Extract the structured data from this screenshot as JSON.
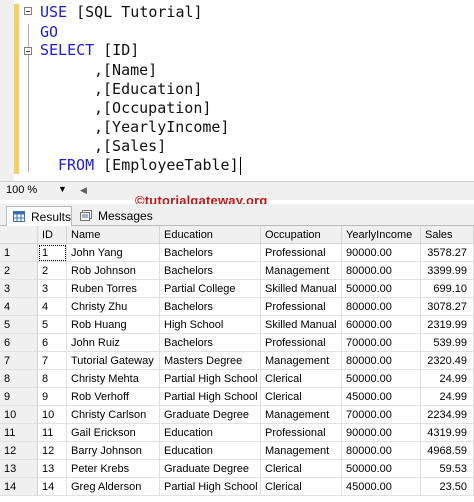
{
  "editor": {
    "lines": [
      {
        "kw": "USE",
        "id": "[SQL Tutorial]"
      },
      {
        "kw": "GO",
        "id": ""
      },
      {
        "kw": "SELECT",
        "id": "[ID]"
      },
      {
        "kw": "",
        "id": ",[Name]"
      },
      {
        "kw": "",
        "id": ",[Education]"
      },
      {
        "kw": "",
        "id": ",[Occupation]"
      },
      {
        "kw": "",
        "id": ",[YearlyIncome]"
      },
      {
        "kw": "",
        "id": ",[Sales]"
      },
      {
        "kw": "FROM",
        "id": "[EmployeeTable]"
      }
    ]
  },
  "status": {
    "zoom": "100 %"
  },
  "watermark": "©tutorialgateway.org",
  "tabs": [
    {
      "label": "Results",
      "icon": "grid-icon"
    },
    {
      "label": "Messages",
      "icon": "messages-icon"
    }
  ],
  "grid": {
    "columns": [
      "ID",
      "Name",
      "Education",
      "Occupation",
      "YearlyIncome",
      "Sales"
    ],
    "rows": [
      [
        "1",
        "1",
        "John Yang",
        "Bachelors",
        "Professional",
        "90000.00",
        "3578.27"
      ],
      [
        "2",
        "2",
        "Rob Johnson",
        "Bachelors",
        "Management",
        "80000.00",
        "3399.99"
      ],
      [
        "3",
        "3",
        "Ruben Torres",
        "Partial College",
        "Skilled Manual",
        "50000.00",
        "699.10"
      ],
      [
        "4",
        "4",
        "Christy Zhu",
        "Bachelors",
        "Professional",
        "80000.00",
        "3078.27"
      ],
      [
        "5",
        "5",
        "Rob Huang",
        "High School",
        "Skilled Manual",
        "60000.00",
        "2319.99"
      ],
      [
        "6",
        "6",
        "John Ruiz",
        "Bachelors",
        "Professional",
        "70000.00",
        "539.99"
      ],
      [
        "7",
        "7",
        "Tutorial Gateway",
        "Masters Degree",
        "Management",
        "80000.00",
        "2320.49"
      ],
      [
        "8",
        "8",
        "Christy Mehta",
        "Partial High School",
        "Clerical",
        "50000.00",
        "24.99"
      ],
      [
        "9",
        "9",
        "Rob Verhoff",
        "Partial High School",
        "Clerical",
        "45000.00",
        "24.99"
      ],
      [
        "10",
        "10",
        "Christy Carlson",
        "Graduate Degree",
        "Management",
        "70000.00",
        "2234.99"
      ],
      [
        "11",
        "11",
        "Gail Erickson",
        "Education",
        "Professional",
        "90000.00",
        "4319.99"
      ],
      [
        "12",
        "12",
        "Barry Johnson",
        "Education",
        "Management",
        "80000.00",
        "4968.59"
      ],
      [
        "13",
        "13",
        "Peter Krebs",
        "Graduate Degree",
        "Clerical",
        "50000.00",
        "59.53"
      ],
      [
        "14",
        "14",
        "Greg Alderson",
        "Partial High School",
        "Clerical",
        "45000.00",
        "23.50"
      ]
    ]
  }
}
